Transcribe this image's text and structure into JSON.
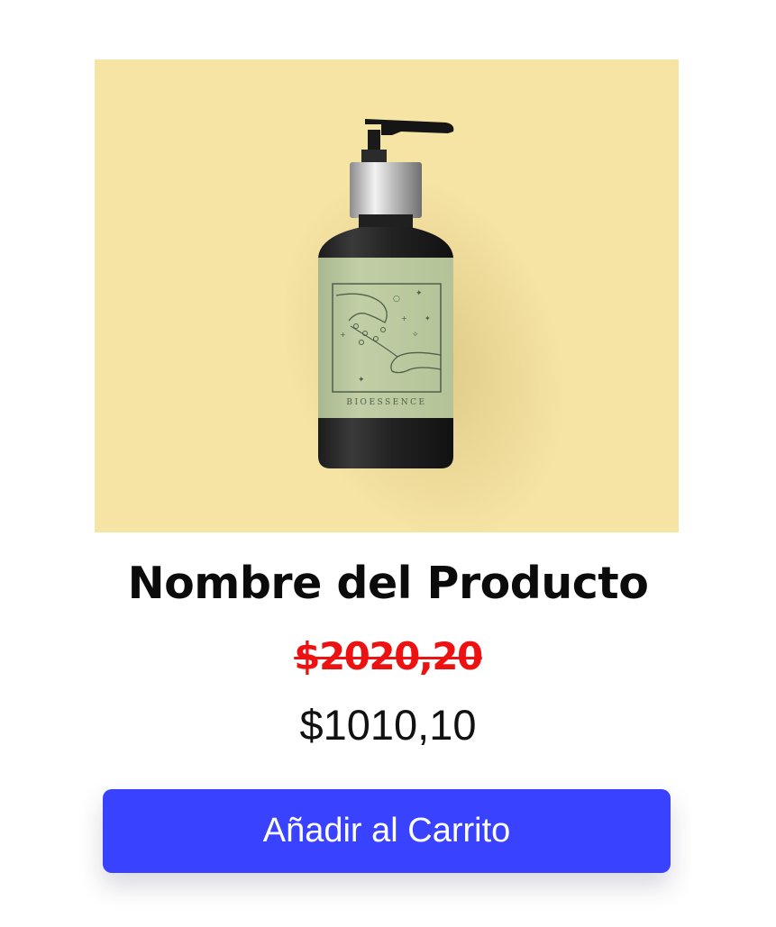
{
  "product": {
    "image_brand_text": "BIOESSENCE",
    "title": "Nombre del Producto",
    "old_price": "$2020,20",
    "price": "$1010,10"
  },
  "actions": {
    "add_to_cart_label": "Añadir al Carrito"
  },
  "colors": {
    "image_background": "#f6e4a5",
    "old_price": "#ee1111",
    "button": "#3943ff",
    "button_text": "#ffffff",
    "title_text": "#0b0b0b"
  }
}
